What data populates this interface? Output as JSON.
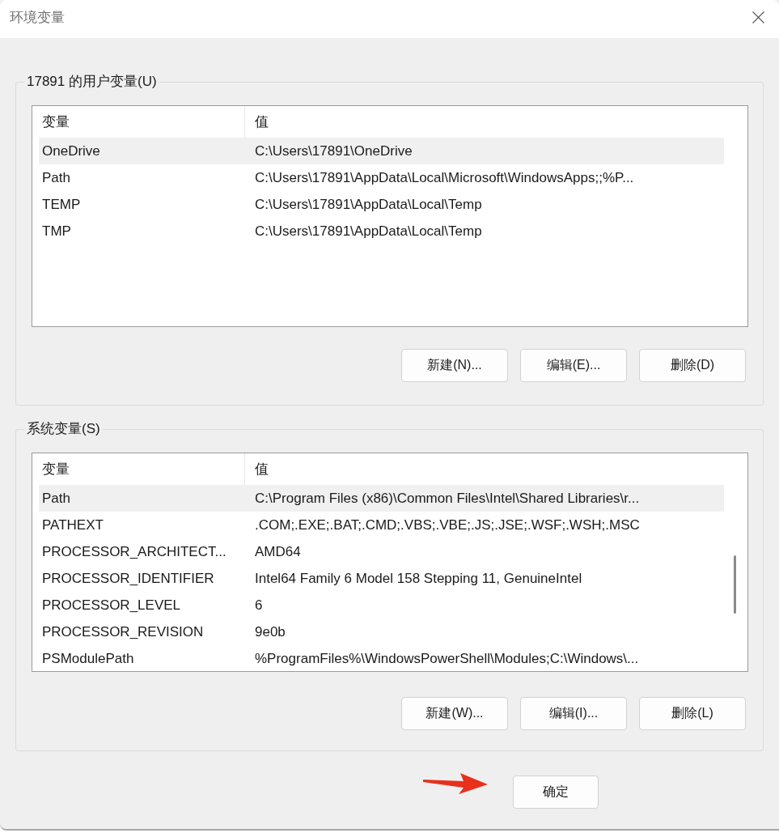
{
  "window": {
    "title": "环境变量"
  },
  "user_variables": {
    "label": "17891 的用户变量(U)",
    "columns": [
      "变量",
      "值"
    ],
    "rows": [
      {
        "name": "OneDrive",
        "value": "C:\\Users\\17891\\OneDrive",
        "selected": true
      },
      {
        "name": "Path",
        "value": "C:\\Users\\17891\\AppData\\Local\\Microsoft\\WindowsApps;;%P...",
        "selected": false
      },
      {
        "name": "TEMP",
        "value": "C:\\Users\\17891\\AppData\\Local\\Temp",
        "selected": false
      },
      {
        "name": "TMP",
        "value": "C:\\Users\\17891\\AppData\\Local\\Temp",
        "selected": false
      }
    ],
    "buttons": [
      "新建(N)...",
      "编辑(E)...",
      "删除(D)"
    ]
  },
  "system_variables": {
    "label": "系统变量(S)",
    "columns": [
      "变量",
      "值"
    ],
    "rows": [
      {
        "name": "Path",
        "value": "C:\\Program Files (x86)\\Common Files\\Intel\\Shared Libraries\\r...",
        "selected": true
      },
      {
        "name": "PATHEXT",
        "value": ".COM;.EXE;.BAT;.CMD;.VBS;.VBE;.JS;.JSE;.WSF;.WSH;.MSC",
        "selected": false
      },
      {
        "name": "PROCESSOR_ARCHITECT...",
        "value": "AMD64",
        "selected": false
      },
      {
        "name": "PROCESSOR_IDENTIFIER",
        "value": "Intel64 Family 6 Model 158 Stepping 11, GenuineIntel",
        "selected": false
      },
      {
        "name": "PROCESSOR_LEVEL",
        "value": "6",
        "selected": false
      },
      {
        "name": "PROCESSOR_REVISION",
        "value": "9e0b",
        "selected": false
      },
      {
        "name": "PSModulePath",
        "value": "%ProgramFiles%\\WindowsPowerShell\\Modules;C:\\Windows\\...",
        "selected": false
      }
    ],
    "buttons": [
      "新建(W)...",
      "编辑(I)...",
      "删除(L)"
    ]
  },
  "buttons": [
    "确定"
  ]
}
